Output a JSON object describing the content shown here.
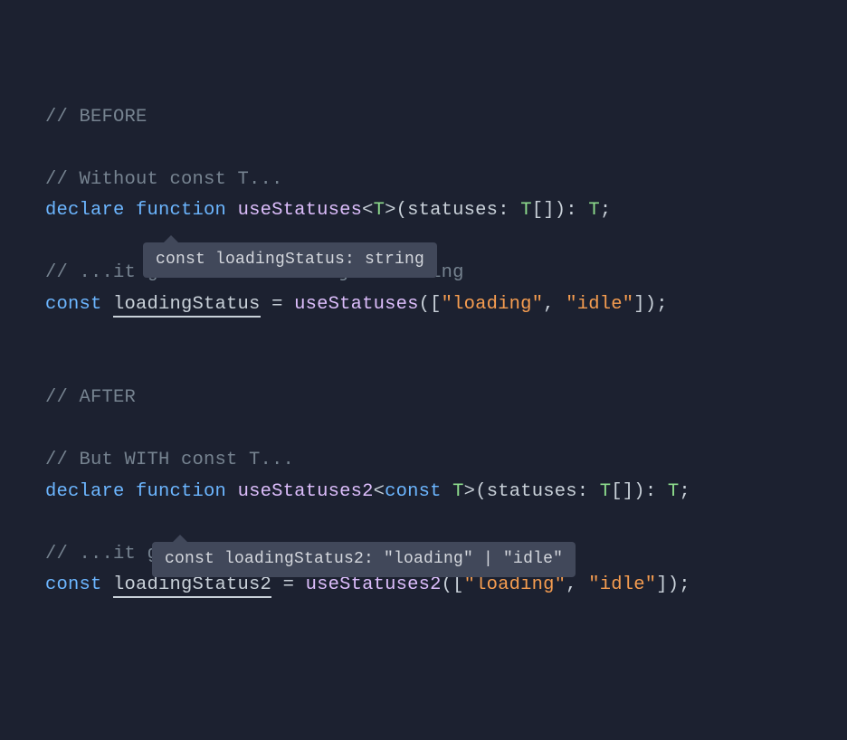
{
  "code": {
    "c1": "// BEFORE",
    "c2": "// Without const T...",
    "kw_declare": "declare",
    "kw_function": "function",
    "fn1": "useStatuses",
    "lt": "<",
    "gt": ">",
    "tp_T": "T",
    "lp": "(",
    "rp": ")",
    "param1": "statuses",
    "colon": ":",
    "brackets": "[]",
    "semi": ";",
    "space": " ",
    "c3": "// ...it gets inferred as just string",
    "kw_const": "const",
    "var1": "loadingStatus",
    "eq": "=",
    "lb": "[",
    "rb": "]",
    "s_loading": "\"loading\"",
    "comma": ",",
    "s_idle": "\"idle\"",
    "c4": "// AFTER",
    "c5": "// But WITH const T...",
    "fn2": "useStatuses2",
    "c6": "// ...it gets inferred as narrowly as possible.",
    "var2": "loadingStatus2"
  },
  "tooltips": {
    "t1": "const loadingStatus: string",
    "t2": "const loadingStatus2: \"loading\" | \"idle\""
  }
}
